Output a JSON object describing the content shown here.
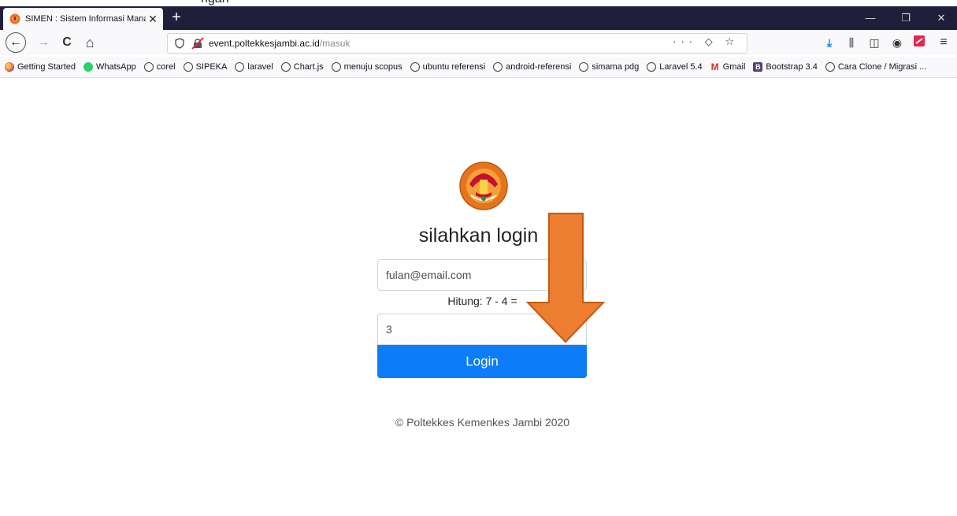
{
  "clipped_text": "ngan",
  "tab": {
    "title": "SIMEN : Sistem Informasi Mana",
    "close": "✕"
  },
  "new_tab": "+",
  "window_controls": {
    "minimize": "—",
    "restore": "❐",
    "close": "✕"
  },
  "nav": {
    "back": "←",
    "forward": "→",
    "reload": "C",
    "home": "⌂"
  },
  "url": {
    "host": "event.poltekkesjambi.ac.id",
    "path": "/masuk",
    "page_actions": "··· ◇ ☆"
  },
  "bookmarks": [
    {
      "label": "Getting Started",
      "icon": "firefox-icon"
    },
    {
      "label": "WhatsApp",
      "icon": "whatsapp-icon"
    },
    {
      "label": "corel",
      "icon": "globe-icon"
    },
    {
      "label": "SIPEKA",
      "icon": "globe-icon"
    },
    {
      "label": "laravel",
      "icon": "globe-icon"
    },
    {
      "label": "Chart.js",
      "icon": "globe-icon"
    },
    {
      "label": "menuju scopus",
      "icon": "globe-icon"
    },
    {
      "label": "ubuntu referensi",
      "icon": "globe-icon"
    },
    {
      "label": "android-referensi",
      "icon": "globe-icon"
    },
    {
      "label": "simama pdg",
      "icon": "globe-icon"
    },
    {
      "label": "Laravel 5.4",
      "icon": "globe-icon"
    },
    {
      "label": "Gmail",
      "icon": "gmail-icon"
    },
    {
      "label": "Bootstrap 3.4",
      "icon": "bootstrap-icon"
    },
    {
      "label": "Cara Clone / Migrasi ...",
      "icon": "globe-icon"
    }
  ],
  "login": {
    "heading": "silahkan login",
    "email_value": "fulan@email.com",
    "captcha_label": "Hitung: 7 - 4 =",
    "captcha_value": "3",
    "button_label": "Login",
    "footer": "© Poltekkes Kemenkes Jambi 2020"
  },
  "colors": {
    "tabbar": "#1f1f3a",
    "primary_button": "#0d7cf8",
    "arrow": "#ed7d31",
    "arrow_outline": "#c55a11"
  }
}
